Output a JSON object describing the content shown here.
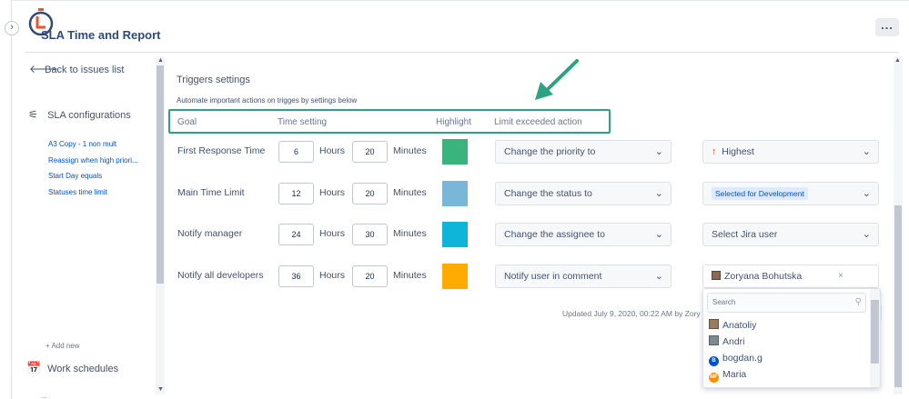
{
  "app": {
    "title": "SLA Time and Report",
    "more_label": "..."
  },
  "sidebar": {
    "back_label": "Back to issues list",
    "sla_section": "SLA configurations",
    "sla_items": [
      "A3 Copy - 1 non mult",
      "Reassign when high priori...",
      "Start Day equals",
      "Statuses time limit"
    ],
    "add_new": "+ Add new",
    "work_schedules": "Work schedules",
    "next_section_hint": "..."
  },
  "triggers": {
    "title": "Triggers settings",
    "subtitle": "Automate important actions on trigges by settings below",
    "columns": {
      "goal": "Goal",
      "time_setting": "Time setting",
      "highlight": "Highlight",
      "action": "Limit exceeded action"
    },
    "hours_label": "Hours",
    "minutes_label": "Minutes",
    "rows": [
      {
        "goal": "First Response Time",
        "hours": "6",
        "minutes": "20",
        "color": "#3bb37c",
        "action": "Change the priority to",
        "value": "Highest"
      },
      {
        "goal": "Main Time Limit",
        "hours": "12",
        "minutes": "20",
        "color": "#7ab6d8",
        "action": "Change the status to",
        "value": "Selected for Development"
      },
      {
        "goal": "Notify manager",
        "hours": "24",
        "minutes": "30",
        "color": "#0fb5d8",
        "action": "Change the assignee to",
        "value": "Select Jira user"
      },
      {
        "goal": "Notify all developers",
        "hours": "36",
        "minutes": "20",
        "color": "#ffab00",
        "action": "Notify user in comment",
        "value": "Zoryana Bohutska"
      }
    ]
  },
  "footer": {
    "updated": "Updated July 9, 2020, 00:22 AM by Zory"
  },
  "user_dropdown": {
    "search_placeholder": "Search",
    "users": [
      {
        "name": "Anatoliy",
        "avatar": "photo"
      },
      {
        "name": "Andri",
        "avatar": "photo"
      },
      {
        "name": "bogdan.g",
        "avatar": "circle",
        "initials": "B",
        "color": "#0052cc"
      },
      {
        "name": "Maria",
        "avatar": "circle",
        "initials": "MF",
        "color": "#ff8b00"
      }
    ]
  },
  "colors": {
    "accent": "#2aa383",
    "link": "#0052cc",
    "priority_highest": "#de350b"
  },
  "icons": [
    "expand-chevron-icon",
    "sla-logo-icon",
    "back-arrow-icon",
    "sliders-icon",
    "calendar-icon",
    "chevron-down-icon",
    "up-arrow-icon",
    "clear-icon",
    "search-icon"
  ]
}
